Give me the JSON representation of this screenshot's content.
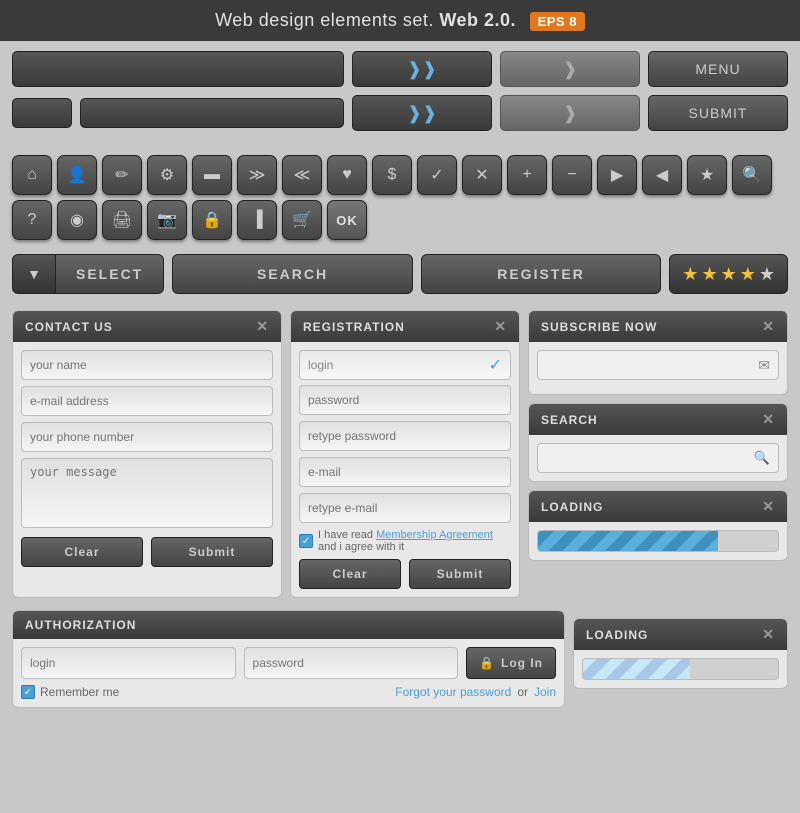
{
  "banner": {
    "text": "Web design elements set.",
    "bold": "Web 2.0.",
    "badge": "EPS 8"
  },
  "controls": {
    "menu_label": "MENU",
    "submit_label": "SUBMIT"
  },
  "icons": [
    {
      "name": "home",
      "symbol": "⌂"
    },
    {
      "name": "user",
      "symbol": "👤"
    },
    {
      "name": "pencil",
      "symbol": "✏"
    },
    {
      "name": "gear",
      "symbol": "⚙"
    },
    {
      "name": "chat",
      "symbol": "💬"
    },
    {
      "name": "chevrons-down",
      "symbol": "⋙"
    },
    {
      "name": "chevrons-up",
      "symbol": "⋘"
    },
    {
      "name": "heart",
      "symbol": "♥"
    },
    {
      "name": "dollar",
      "symbol": "$"
    },
    {
      "name": "check",
      "symbol": "✓"
    },
    {
      "name": "close",
      "symbol": "✕"
    },
    {
      "name": "plus",
      "symbol": "+"
    },
    {
      "name": "minus",
      "symbol": "−"
    },
    {
      "name": "arrow-right",
      "symbol": "▶"
    },
    {
      "name": "arrow-left",
      "symbol": "◀"
    },
    {
      "name": "star",
      "symbol": "★"
    },
    {
      "name": "search",
      "symbol": "🔍"
    },
    {
      "name": "question",
      "symbol": "?"
    },
    {
      "name": "rss",
      "symbol": "◉"
    },
    {
      "name": "print",
      "symbol": "🖨"
    },
    {
      "name": "camera",
      "symbol": "📷"
    },
    {
      "name": "lock",
      "symbol": "🔒"
    },
    {
      "name": "bar-chart",
      "symbol": "📊"
    },
    {
      "name": "cart",
      "symbol": "🛒"
    },
    {
      "name": "ok",
      "symbol": "OK"
    }
  ],
  "action_buttons": {
    "select": "SELECT",
    "search": "SEARCH",
    "register": "REGISTER"
  },
  "stars": [
    true,
    true,
    true,
    true,
    false
  ],
  "contact_form": {
    "title": "CONTACT US",
    "name_placeholder": "your name",
    "email_placeholder": "e-mail address",
    "phone_placeholder": "your phone number",
    "message_placeholder": "your message",
    "clear_btn": "Clear",
    "submit_btn": "Submit"
  },
  "registration_form": {
    "title": "REGISTRATION",
    "login_placeholder": "login",
    "password_placeholder": "password",
    "retype_password_placeholder": "retype password",
    "email_placeholder": "e-mail",
    "retype_email_placeholder": "retype e-mail",
    "agreement_text": "I have read",
    "agreement_link": "Membership Agreement",
    "agreement_suffix": "and i agree with it",
    "clear_btn": "Clear",
    "submit_btn": "Submit"
  },
  "subscribe_form": {
    "title": "SUBSCRIBE NOW",
    "email_placeholder": ""
  },
  "search_widget": {
    "title": "SEARCH"
  },
  "loading1": {
    "title": "LOADING",
    "progress": 75
  },
  "loading2": {
    "title": "LOADING",
    "progress": 55
  },
  "auth_form": {
    "title": "AUTHORIZATION",
    "login_placeholder": "login",
    "password_placeholder": "password",
    "log_btn": "Log In",
    "remember_label": "Remember me",
    "forgot_link": "Forgot your password",
    "join_prefix": "or",
    "join_link": "Join"
  }
}
